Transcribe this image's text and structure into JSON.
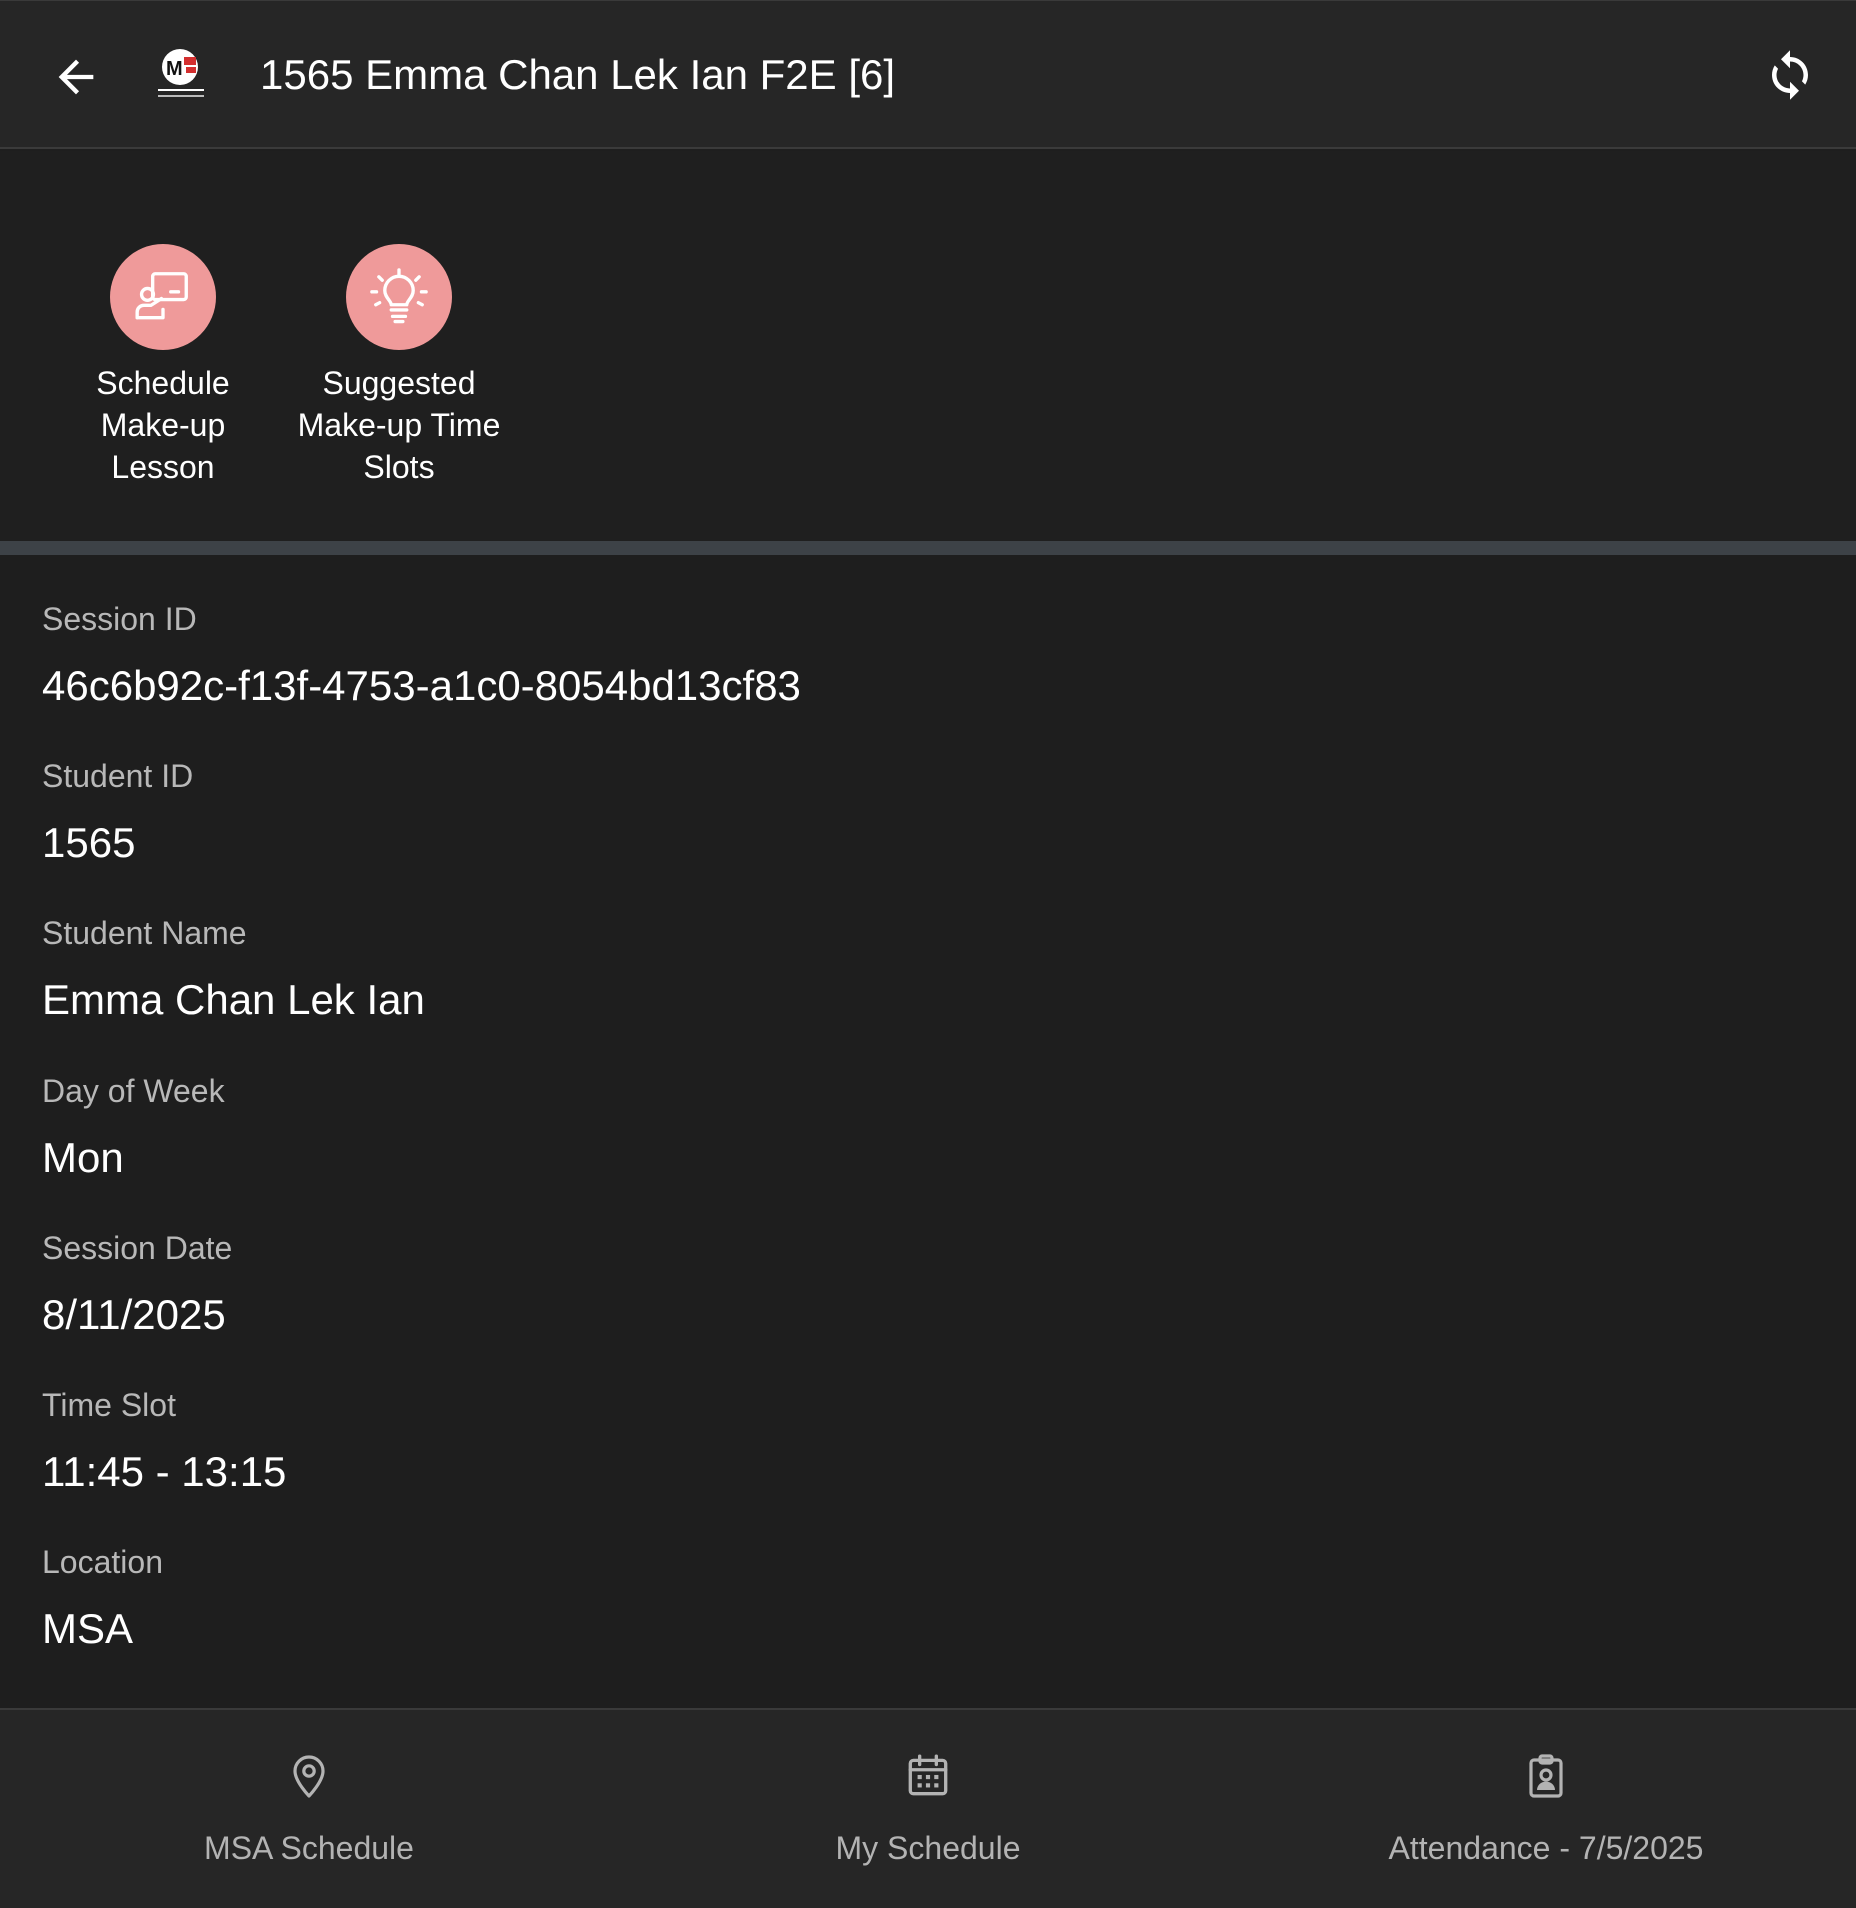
{
  "header": {
    "title": "1565 Emma Chan Lek Ian F2E [6]",
    "back_icon": "arrow-left-icon",
    "logo_icon": "msa-logo",
    "sync_icon": "sync-icon"
  },
  "actions": [
    {
      "label": "Schedule Make-up Lesson",
      "icon": "teacher-board-icon"
    },
    {
      "label": "Suggested Make-up Time Slots",
      "icon": "lightbulb-icon"
    }
  ],
  "fields": {
    "session_id": {
      "label": "Session ID",
      "value": "46c6b92c-f13f-4753-a1c0-8054bd13cf83"
    },
    "student_id": {
      "label": "Student ID",
      "value": "1565"
    },
    "student_name": {
      "label": "Student Name",
      "value": "Emma Chan Lek Ian"
    },
    "day_of_week": {
      "label": "Day of Week",
      "value": "Mon"
    },
    "session_date": {
      "label": "Session Date",
      "value": "8/11/2025"
    },
    "time_slot": {
      "label": "Time Slot",
      "value": "11:45 - 13:15"
    },
    "location": {
      "label": "Location",
      "value": "MSA"
    }
  },
  "bottom_nav": [
    {
      "label": "MSA Schedule",
      "icon": "map-pin-icon"
    },
    {
      "label": "My Schedule",
      "icon": "calendar-icon"
    },
    {
      "label": "Attendance - 7/5/2025",
      "icon": "clipboard-user-icon"
    }
  ],
  "colors": {
    "accent": "#ef9a9a",
    "background": "#1e1e1e",
    "header": "#262626",
    "divider": "#3d4247"
  }
}
